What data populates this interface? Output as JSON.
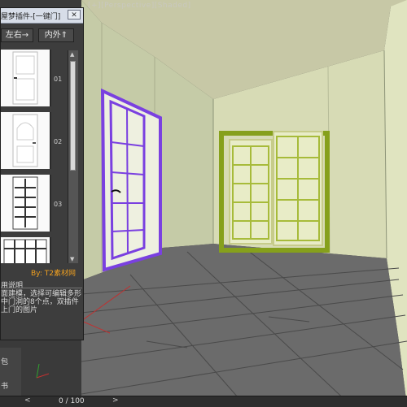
{
  "viewport": {
    "corner_label": "[+][Perspective][Shaded]"
  },
  "plugin": {
    "title": "屋梦插件-[一键门]",
    "close_icon": "close-icon",
    "btn_lr": "左右→",
    "btn_inout": "内外⇑",
    "items": [
      {
        "num": "01"
      },
      {
        "num": "02"
      },
      {
        "num": "03"
      }
    ],
    "by_label": "By: T2素材网",
    "help_title": "用说明",
    "help_text": "面建模，选择可编辑多形中门洞的8个点，双插件上门的图片"
  },
  "side_panel": {
    "item1": "包",
    "item2": "书"
  },
  "status": {
    "frame": "0 / 100",
    "prev_icon": "chevron-left-icon",
    "next_icon": "chevron-right-icon"
  },
  "colors": {
    "selected_door": "#7a40e0",
    "slider_door": "#86a01c",
    "floor": "#666666",
    "walls": "#d8dbb6"
  }
}
